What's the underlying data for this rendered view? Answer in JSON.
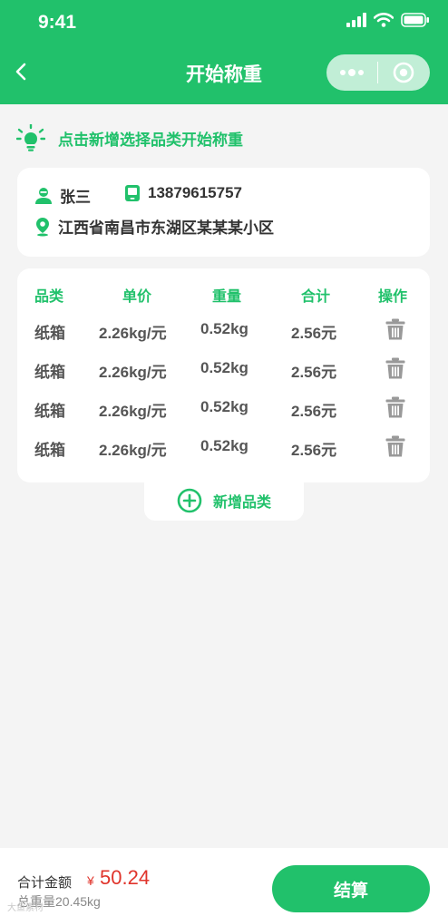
{
  "status_bar": {
    "time": "9:41"
  },
  "header": {
    "title": "开始称重"
  },
  "tip": {
    "text": "点击新增选择品类开始称重"
  },
  "user": {
    "name": "张三",
    "phone": "13879615757",
    "address": "江西省南昌市东湖区某某某小区"
  },
  "table": {
    "headers": [
      "品类",
      "单价",
      "重量",
      "合计",
      "操作"
    ],
    "rows": [
      [
        "纸箱",
        "2.26kg/元",
        "0.52kg",
        "2.56元"
      ],
      [
        "纸箱",
        "2.26kg/元",
        "0.52kg",
        "2.56元"
      ],
      [
        "纸箱",
        "2.26kg/元",
        "0.52kg",
        "2.56元"
      ],
      [
        "纸箱",
        "2.26kg/元",
        "0.52kg",
        "2.56元"
      ]
    ]
  },
  "add_category": {
    "label": "新增品类"
  },
  "footer": {
    "total_label": "合计金额",
    "currency": "¥",
    "total_amount": "50.24",
    "weight_text": "总重量20.45kg",
    "checkout_label": "结算"
  },
  "watermark": "大鱼素材",
  "colors": {
    "brand": "#21c16b",
    "price": "#e0342b",
    "background": "#f4f4f4"
  },
  "icons": {
    "back": "chevron-left-icon",
    "menu": "more-dots-icon",
    "close": "target-circle-icon",
    "tip": "lightbulb-icon",
    "user": "person-icon",
    "phone": "phone-icon",
    "address": "location-pin-icon",
    "delete": "trash-icon",
    "add": "plus-circle-icon"
  }
}
